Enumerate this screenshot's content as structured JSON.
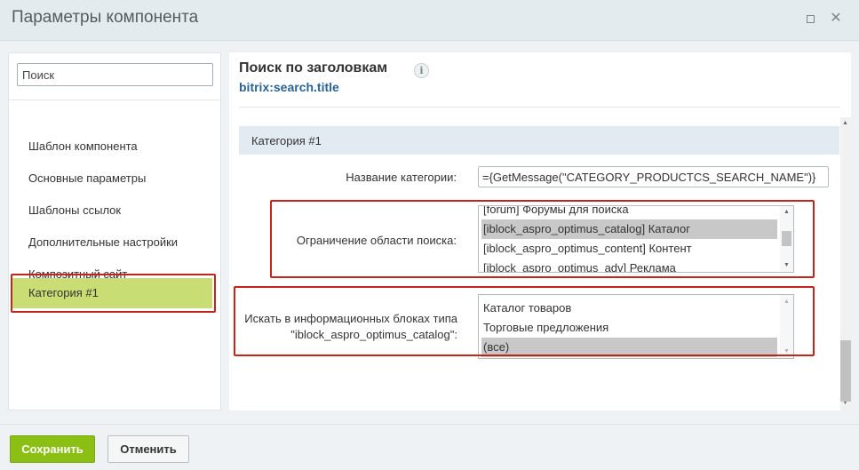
{
  "window": {
    "title": "Параметры компонента",
    "maximize_icon": "maximize-icon",
    "close_icon": "close-icon",
    "close_glyph": "✕"
  },
  "sidebar": {
    "search_placeholder": "Поиск",
    "items": [
      {
        "label": "Шаблон компонента"
      },
      {
        "label": "Основные параметры"
      },
      {
        "label": "Шаблоны ссылок"
      },
      {
        "label": "Дополнительные настройки"
      },
      {
        "label": "Композитный сайт"
      },
      {
        "label": "Категория #1",
        "active": true
      }
    ]
  },
  "component": {
    "title": "Поиск по заголовкам",
    "info_glyph": "i",
    "code": "bitrix:search.title"
  },
  "section": {
    "title": "Категория #1",
    "fields": {
      "category_name": {
        "label": "Название категории:",
        "value": "={GetMessage(\"CATEGORY_PRODUCTCS_SEARCH_NAME\")}"
      },
      "search_scope": {
        "label": "Ограничение области поиска:",
        "options": [
          {
            "text": "[forum] Форумы для поиска",
            "selected": false
          },
          {
            "text": "[iblock_aspro_optimus_catalog] Каталог",
            "selected": true
          },
          {
            "text": "[iblock_aspro_optimus_content] Контент",
            "selected": false
          },
          {
            "text": "[iblock_aspro_optimus_adv] Реклама",
            "selected": false
          }
        ]
      },
      "iblock_search": {
        "label_line1": "Искать в информационных блоках типа",
        "label_line2": "\"iblock_aspro_optimus_catalog\":",
        "options": [
          {
            "text": "Каталог товаров",
            "selected": false
          },
          {
            "text": "Торговые предложения",
            "selected": false
          },
          {
            "text": "(все)",
            "selected": true
          }
        ]
      }
    }
  },
  "footer": {
    "save_label": "Сохранить",
    "cancel_label": "Отменить"
  },
  "colors": {
    "titlebar_bg": "#e4ebee",
    "active_item_bg": "#c8dd73",
    "save_button_bg": "#8cbf14",
    "highlight_border": "#c1261d",
    "link_color": "#2a6496",
    "section_header_bg": "#e3ebf2"
  }
}
